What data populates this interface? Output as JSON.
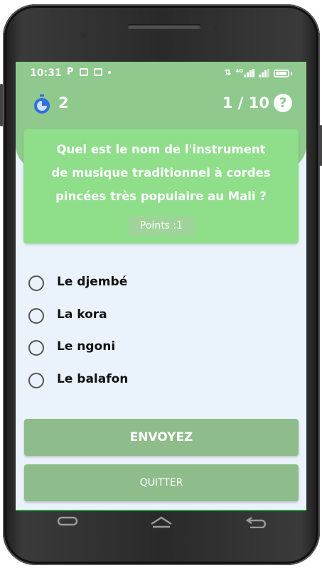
{
  "status_bar": {
    "time": "10:31",
    "icons": [
      "p-icon",
      "message-icon",
      "app-icon",
      "dot-icon",
      "data-icon",
      "signal-4g-icon",
      "signal-icon",
      "battery-icon"
    ],
    "p_glyph": "P",
    "network_label": "4G"
  },
  "header": {
    "timer_count": "2",
    "progress": "1 / 10",
    "help_glyph": "?",
    "color": "#8fc98d"
  },
  "question": {
    "text": "Quel est le nom de l'instrument de musique traditionnel à cordes pincées très populaire au Mali ?",
    "lines": [
      "Quel est le nom de l'instrument",
      "de musique traditionnel à cordes",
      "pincées très populaire au Mali ?"
    ],
    "points_label": "Points :1",
    "card_color": "#8ede8a"
  },
  "options": [
    {
      "label": "Le djembé",
      "selected": false
    },
    {
      "label": "La kora",
      "selected": false
    },
    {
      "label": "Le ngoni",
      "selected": false
    },
    {
      "label": "Le balafon",
      "selected": false
    }
  ],
  "buttons": {
    "send": "ENVOYEZ",
    "quit": "QUITTER",
    "color": "#8ebd8b"
  },
  "nav": {
    "icons": [
      "recent-apps-icon",
      "home-icon",
      "back-icon"
    ]
  }
}
